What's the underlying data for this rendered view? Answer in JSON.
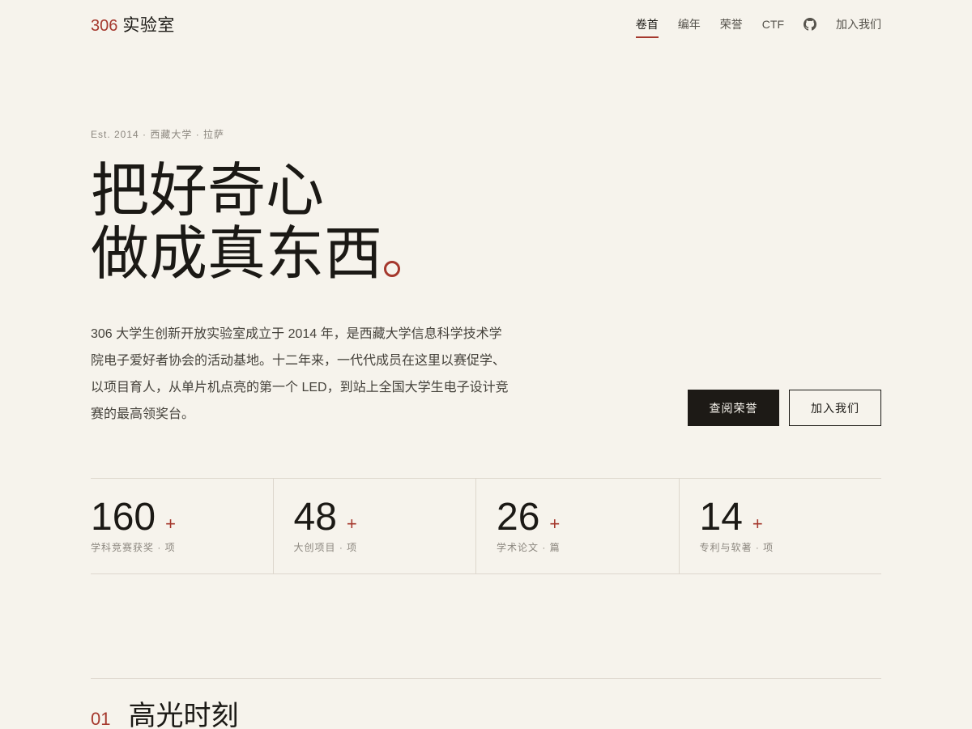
{
  "brand": {
    "number": "306",
    "name": "实验室"
  },
  "nav": {
    "items": [
      {
        "label": "卷首",
        "active": true
      },
      {
        "label": "编年",
        "active": false
      },
      {
        "label": "荣誉",
        "active": false
      },
      {
        "label": "CTF",
        "active": false
      },
      {
        "label": "加入我们",
        "active": false
      }
    ],
    "github_icon": "github-icon"
  },
  "hero": {
    "est": "Est. 2014 · 西藏大学 · 拉萨",
    "title_line1": "把好奇心",
    "title_line2": "做成真东西",
    "description": "306 大学生创新开放实验室成立于 2014 年，是西藏大学信息科学技术学院电子爱好者协会的活动基地。十二年来，一代代成员在这里以赛促学、以项目育人，从单片机点亮的第一个 LED，到站上全国大学生电子设计竞赛的最高领奖台。",
    "primary_button": "查阅荣誉",
    "secondary_button": "加入我们"
  },
  "stats": [
    {
      "value": "160",
      "plus": "+",
      "label": "学科竞赛获奖 · 项"
    },
    {
      "value": "48",
      "plus": "+",
      "label": "大创项目 · 项"
    },
    {
      "value": "26",
      "plus": "+",
      "label": "学术论文 · 篇"
    },
    {
      "value": "14",
      "plus": "+",
      "label": "专利与软著 · 项"
    }
  ],
  "section": {
    "number": "01",
    "title": "高光时刻"
  },
  "colors": {
    "accent": "#a5382d",
    "background": "#f6f3ec",
    "text": "#1b1915"
  }
}
